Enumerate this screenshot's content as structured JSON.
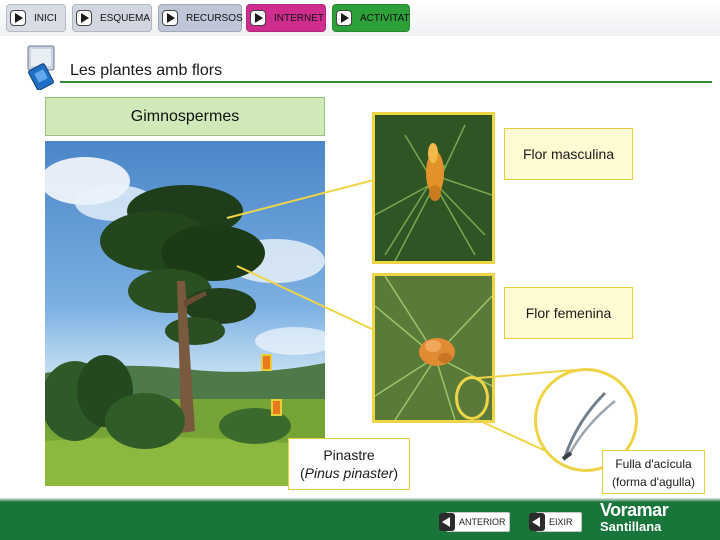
{
  "nav": {
    "inici": "INICI",
    "esquema": "ESQUEMA",
    "recursos": "RECURSOS",
    "internet": "INTERNET",
    "activitat": "ACTIVITAT"
  },
  "page": {
    "title": "Les plantes amb flors",
    "section": "Gimnospermes"
  },
  "labels": {
    "male_flower": "Flor masculina",
    "female_flower": "Flor femenina",
    "species_common": "Pinastre",
    "species_open": "(",
    "species_scientific": "Pinus pinaster",
    "species_close": ")",
    "leaf_line1": "Fulla d'acícula",
    "leaf_line2": "(forma d'agulla)"
  },
  "footer": {
    "anterior": "ANTERIOR",
    "eixir": "EIXIR",
    "brand_top": "Voramar",
    "brand_bottom": "Santillana"
  },
  "colors": {
    "brand_green": "#19763a",
    "highlight_yellow": "#f0d447",
    "internet_pink": "#cf2d8e",
    "activitat_green": "#2da03a",
    "section_green": "#cfe9b8"
  }
}
